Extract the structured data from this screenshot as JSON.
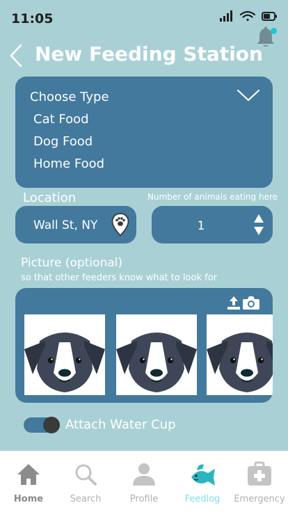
{
  "status": {
    "time": "11:05"
  },
  "header": {
    "title": "New Feeding Station"
  },
  "type_select": {
    "label": "Choose Type",
    "options": [
      "Cat Food",
      "Dog Food",
      "Home Food"
    ]
  },
  "location": {
    "label": "Location",
    "value": "Wall St, NY"
  },
  "animal_count": {
    "label": "Number of animals eating here",
    "value": "1"
  },
  "picture": {
    "label": "Picture (optional)",
    "sublabel": "so that other feeders know what to look for",
    "photo_count": 3
  },
  "water_cup": {
    "label": "Attach Water Cup",
    "enabled": true
  },
  "tabs": [
    {
      "label": "Home",
      "icon": "home-icon"
    },
    {
      "label": "Search",
      "icon": "search-icon"
    },
    {
      "label": "Profile",
      "icon": "profile-icon"
    },
    {
      "label": "Feedlog",
      "icon": "fish-icon"
    },
    {
      "label": "Emergency",
      "icon": "first-aid-icon"
    }
  ],
  "colors": {
    "background": "#a9d1d5",
    "card": "#42799c",
    "active_tab": "#2bb5c0",
    "notification_dot": "#1fc6d1"
  }
}
